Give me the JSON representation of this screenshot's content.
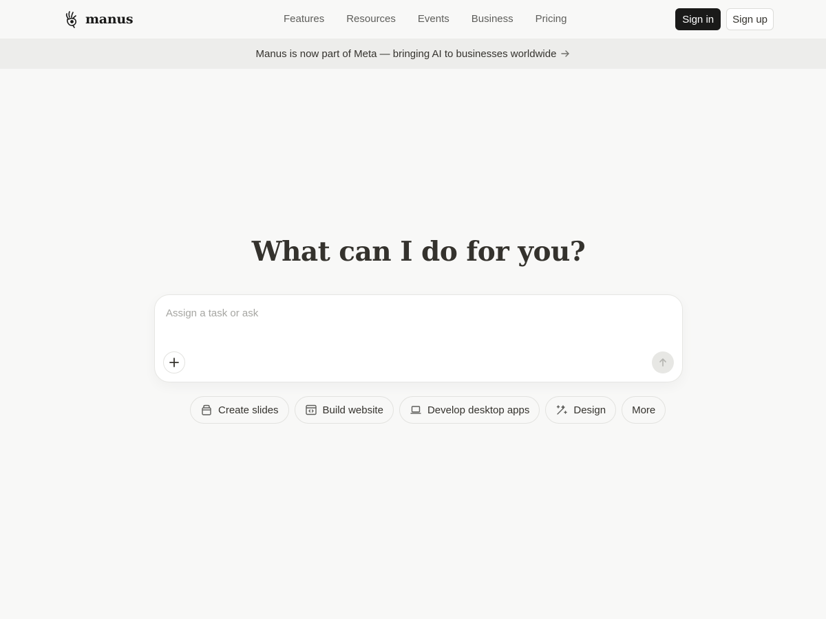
{
  "header": {
    "logo_text": "manus",
    "nav": [
      {
        "label": "Features"
      },
      {
        "label": "Resources"
      },
      {
        "label": "Events"
      },
      {
        "label": "Business"
      },
      {
        "label": "Pricing"
      }
    ],
    "sign_in": "Sign in",
    "sign_up": "Sign up"
  },
  "banner": {
    "text": "Manus is now part of Meta — bringing AI to businesses worldwide",
    "icon": "arrow-right-icon"
  },
  "hero": {
    "headline": "What can I do for you?"
  },
  "composer": {
    "placeholder": "Assign a task or ask",
    "value": "",
    "add_icon": "plus-icon",
    "send_icon": "arrow-up-icon"
  },
  "quick_actions": [
    {
      "label": "Create slides",
      "icon": "slides-icon"
    },
    {
      "label": "Build website",
      "icon": "browser-code-icon"
    },
    {
      "label": "Develop desktop apps",
      "icon": "laptop-icon"
    },
    {
      "label": "Design",
      "icon": "design-wand-icon"
    },
    {
      "label": "More",
      "icon": ""
    }
  ],
  "colors": {
    "background": "#f8f8f7",
    "banner": "#ededeb",
    "primary_button": "#1a1a19",
    "text": "#34322d"
  }
}
